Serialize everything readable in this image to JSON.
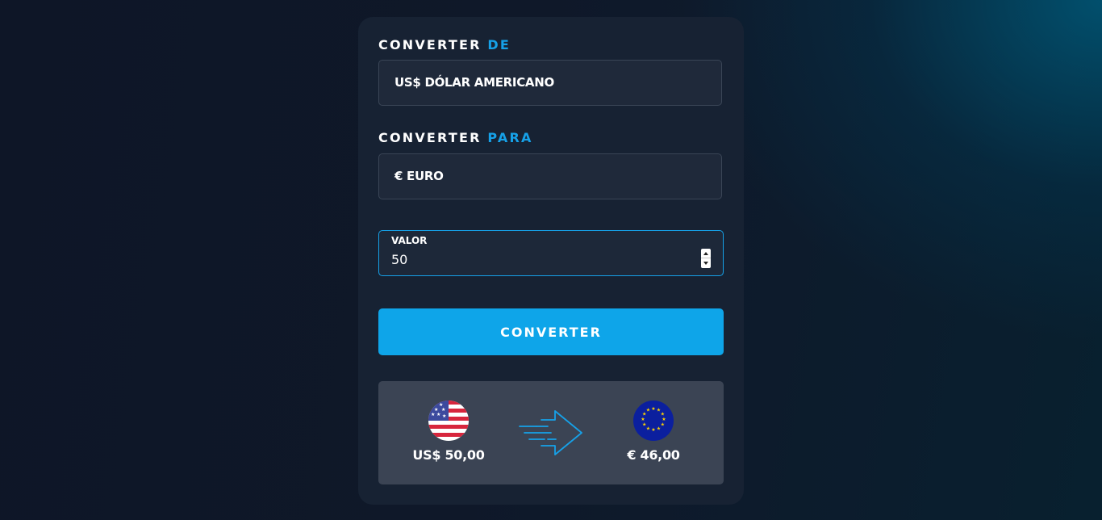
{
  "form": {
    "from_label_prefix": "CONVERTER",
    "from_label_accent": "DE",
    "from_selected": "US$ DÓLAR AMERICANO",
    "to_label_prefix": "CONVERTER",
    "to_label_accent": "PARA",
    "to_selected": "€ EURO",
    "value_label": "VALOR",
    "value": "50",
    "submit_label": "CONVERTER"
  },
  "result": {
    "from_flag_icon": "us-flag-icon",
    "from_amount": "US$ 50,00",
    "arrow_icon": "fast-arrow-right-icon",
    "to_flag_icon": "eu-flag-icon",
    "to_amount": "€ 46,00"
  },
  "colors": {
    "accent": "#16a1e8",
    "button": "#0ea5e9",
    "card": "#172233",
    "result_panel": "#3b4454"
  }
}
